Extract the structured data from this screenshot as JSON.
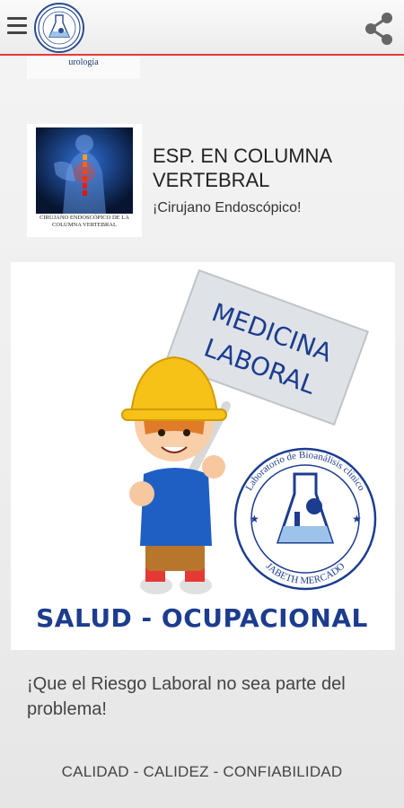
{
  "toolbar": {
    "menu_icon": "menu-icon",
    "share_icon": "share-icon",
    "logo_caption": "urología",
    "accent_color": "#e53935"
  },
  "promo": {
    "thumb_caption": "CIRUJANO ENDOSCÓPICO DE LA COLUMNA VERTEBRAL",
    "title": "ESP. EN COLUMNA VERTEBRAL",
    "subtitle": "¡Cirujano Endoscópico!"
  },
  "banner": {
    "sign_line1": "MEDICINA",
    "sign_line2": "LABORAL",
    "lab_ring_top": "Laboratorio de Bioanálisis clínico",
    "lab_ring_bottom": "JABETH MERCADO",
    "caption": "SALUD - OCUPACIONAL"
  },
  "tagline": "¡Que el Riesgo Laboral no sea parte del problema!",
  "footer": "CALIDAD - CALIDEZ - CONFIABILIDAD"
}
